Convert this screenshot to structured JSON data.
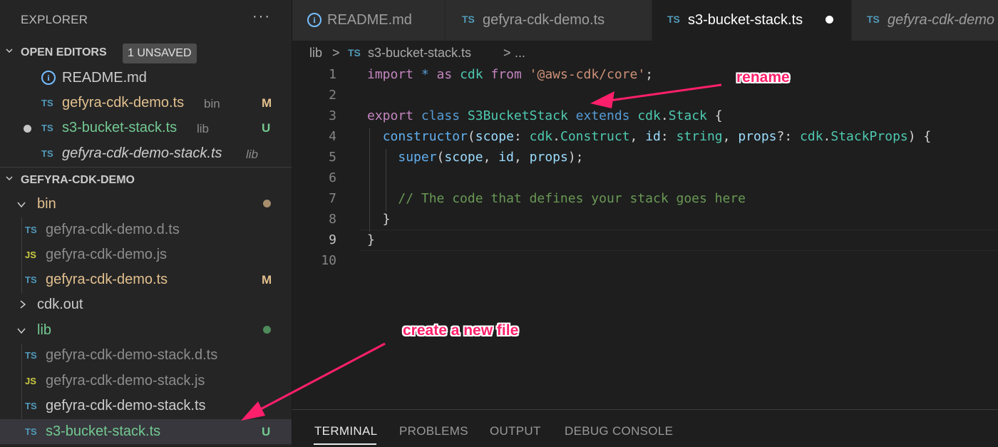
{
  "sidebar": {
    "title": "EXPLORER",
    "more": "···",
    "open_editors": {
      "header": "OPEN EDITORS",
      "badge": "1 UNSAVED",
      "items": [
        {
          "icon": "info-icon",
          "name": "README.md",
          "sub": "",
          "git": ""
        },
        {
          "icon": "TS",
          "name": "gefyra-cdk-demo.ts",
          "sub": "bin",
          "git": "M"
        },
        {
          "icon": "TS",
          "name": "s3-bucket-stack.ts",
          "sub": "lib",
          "git": "U"
        },
        {
          "icon": "TS",
          "name": "gefyra-cdk-demo-stack.ts",
          "sub": "lib",
          "git": ""
        }
      ]
    },
    "project": {
      "header": "GEFYRA-CDK-DEMO",
      "items": [
        {
          "icon": "",
          "name": "bin"
        },
        {
          "icon": "TS",
          "name": "gefyra-cdk-demo.d.ts"
        },
        {
          "icon": "JS",
          "name": "gefyra-cdk-demo.js"
        },
        {
          "icon": "TS",
          "name": "gefyra-cdk-demo.ts",
          "git": "M"
        },
        {
          "icon": "",
          "name": "cdk.out"
        },
        {
          "icon": "",
          "name": "lib"
        },
        {
          "icon": "TS",
          "name": "gefyra-cdk-demo-stack.d.ts"
        },
        {
          "icon": "JS",
          "name": "gefyra-cdk-demo-stack.js"
        },
        {
          "icon": "TS",
          "name": "gefyra-cdk-demo-stack.ts"
        },
        {
          "icon": "TS",
          "name": "s3-bucket-stack.ts",
          "git": "U"
        }
      ]
    }
  },
  "tabs": [
    {
      "icon": "info-icon",
      "label": "README.md"
    },
    {
      "icon": "TS",
      "label": "gefyra-cdk-demo.ts"
    },
    {
      "icon": "TS",
      "label": "s3-bucket-stack.ts",
      "active": true,
      "unsaved": true
    },
    {
      "icon": "TS",
      "label": "gefyra-cdk-demo"
    }
  ],
  "breadcrumb": {
    "folder": "lib",
    "sep": ">",
    "icon": "TS",
    "file": "s3-bucket-stack.ts",
    "more": "..."
  },
  "editor": {
    "line_numbers": [
      "1",
      "2",
      "3",
      "4",
      "5",
      "6",
      "7",
      "8",
      "9",
      "10"
    ],
    "current_line": "9",
    "lines": {
      "l1": {
        "import": "import",
        "star": " * ",
        "as": "as",
        "sp1": " ",
        "cdk": "cdk",
        "sp2": " ",
        "from": "from",
        "sp3": " ",
        "str": "'@aws-cdk/core'",
        "semi": ";"
      },
      "l3": {
        "export": "export",
        "sp1": " ",
        "class": "class",
        "sp2": " ",
        "name": "S3BucketStack",
        "sp3": " ",
        "extends": "extends",
        "sp4": " ",
        "cdk": "cdk",
        "dot": ".",
        "stack": "Stack",
        "brace": " {"
      },
      "l4": {
        "indent": "  ",
        "ctor": "constructor",
        "p1": "(",
        "scope": "scope",
        "c1": ": ",
        "cdk1": "cdk",
        "d1": ".",
        "construct": "Construct",
        "cm1": ", ",
        "id": "id",
        "c2": ": ",
        "string": "string",
        "cm2": ", ",
        "props": "props",
        "q": "?: ",
        "cdk2": "cdk",
        "d2": ".",
        "stackprops": "StackProps",
        "end": ") {"
      },
      "l5": {
        "indent": "    ",
        "super": "super",
        "p1": "(",
        "scope": "scope",
        "cm1": ", ",
        "id": "id",
        "cm2": ", ",
        "props": "props",
        "end": ");"
      },
      "l7": {
        "indent": "    ",
        "comment": "// The code that defines your stack goes here"
      },
      "l8": {
        "text": "  }"
      },
      "l9": {
        "text": "}"
      }
    }
  },
  "panel": {
    "tabs": [
      "TERMINAL",
      "PROBLEMS",
      "OUTPUT",
      "DEBUG CONSOLE"
    ],
    "active": "TERMINAL"
  },
  "annotations": {
    "rename": "rename",
    "create": "create a new file"
  },
  "colors": {
    "modified": "#e2c08d",
    "untracked": "#73c991",
    "annotation": "#ff1f6b"
  }
}
